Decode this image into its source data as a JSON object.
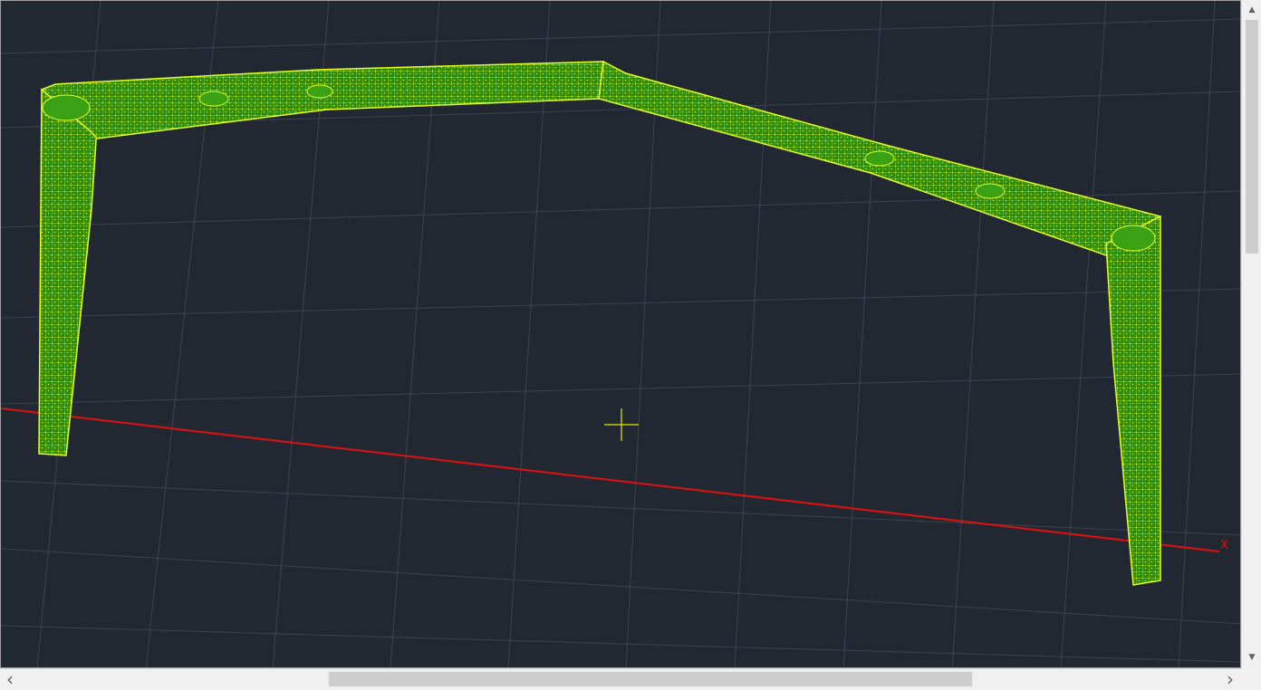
{
  "viewport": {
    "background": "#212831",
    "grid_color": "#3c4452",
    "x_axis_color": "#e01010",
    "x_axis_label": "X",
    "crosshair_color": "#e8e800",
    "mesh_color": "#d8f000",
    "mesh_fill": "#2f8a10"
  },
  "scrollbars": {
    "up_icon": "▲",
    "down_icon": "▼",
    "left_icon": "‹",
    "right_icon": "›",
    "vertical_thumb_position": 0.0,
    "horizontal_thumb_position": 0.37
  }
}
